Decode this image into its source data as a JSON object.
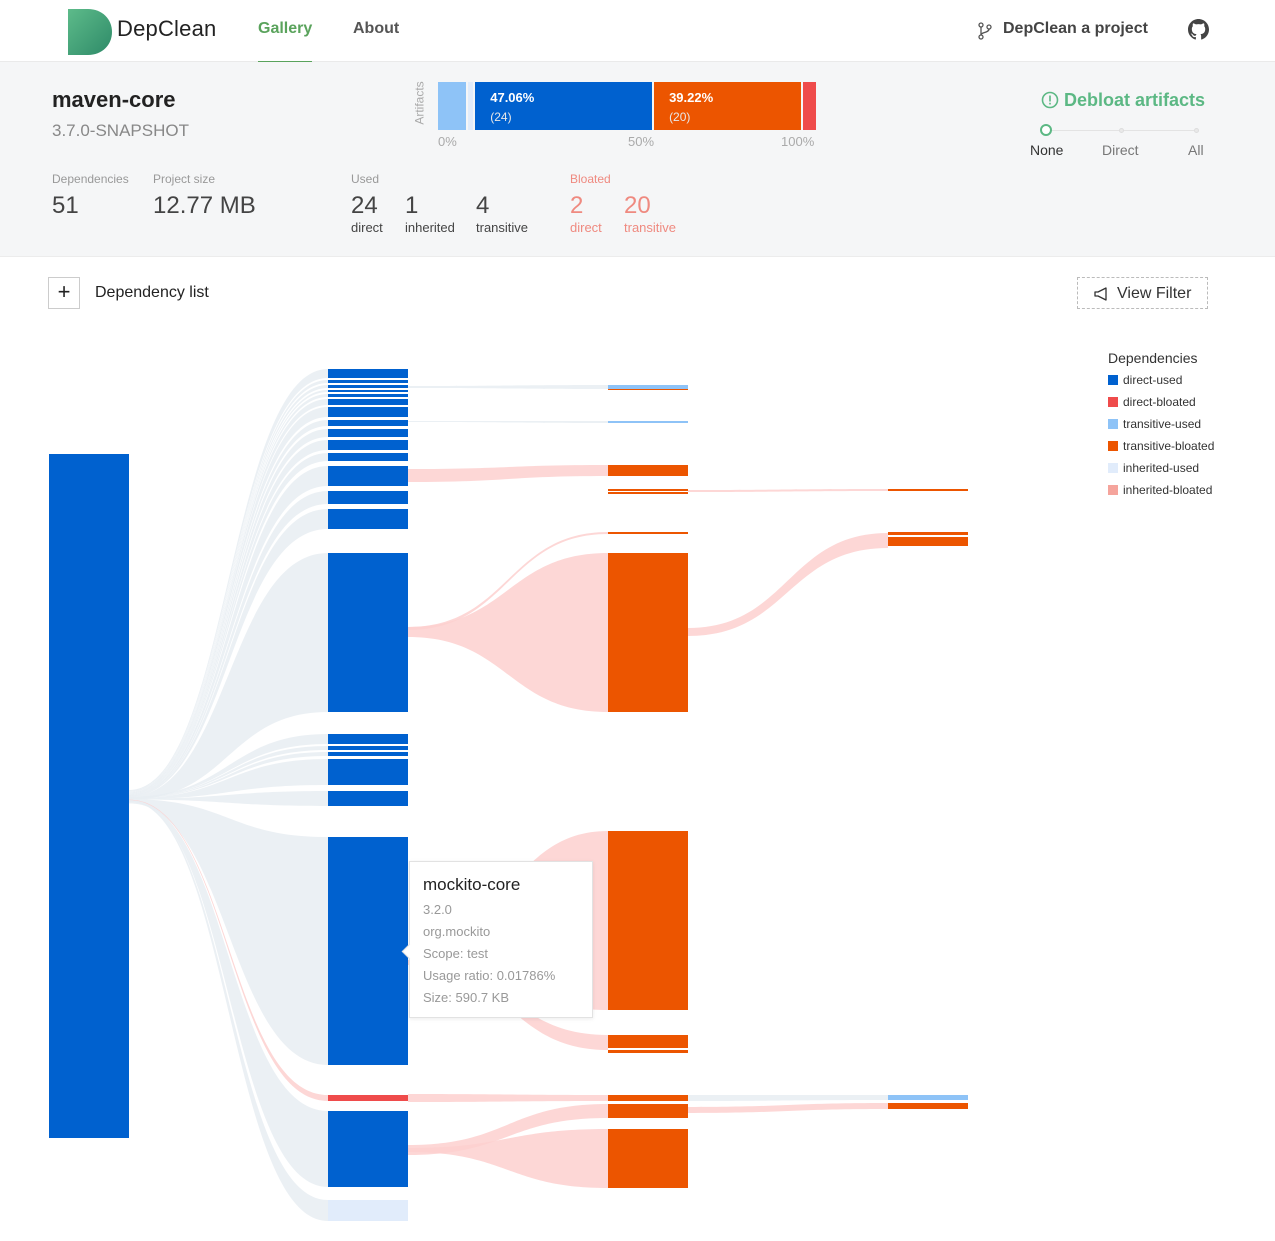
{
  "brand": {
    "name": "DepClean"
  },
  "nav": {
    "gallery": "Gallery",
    "about": "About",
    "cta": "DepClean a project"
  },
  "project": {
    "name": "maven-core",
    "version": "3.7.0-SNAPSHOT"
  },
  "stats": {
    "dependencies_label": "Dependencies",
    "dependencies": "51",
    "size_label": "Project size",
    "size": "12.77 MB",
    "used_label": "Used",
    "used_direct": "24",
    "used_direct_label": "direct",
    "used_inherited": "1",
    "used_inherited_label": "inherited",
    "used_transitive": "4",
    "used_transitive_label": "transitive",
    "bloated_label": "Bloated",
    "bloated_direct": "2",
    "bloated_direct_label": "direct",
    "bloated_transitive": "20",
    "bloated_transitive_label": "transitive"
  },
  "artifacts_bar": {
    "label": "Artifacts",
    "segments": [
      {
        "name": "transitive-used",
        "value": 0.0784,
        "color": "#8ec3f7"
      },
      {
        "name": "inherited-used",
        "value": 0.0196,
        "color": "#e1ecfb"
      },
      {
        "name": "direct-used",
        "value": 0.4706,
        "color": "#0061cf",
        "pct": "47.06%",
        "count": "(24)"
      },
      {
        "name": "transitive-bloated",
        "value": 0.3922,
        "color": "#ec5500",
        "pct": "39.22%",
        "count": "(20)"
      },
      {
        "name": "direct-bloated",
        "value": 0.0392,
        "color": "#ef4b4b"
      }
    ],
    "ticks": [
      "0%",
      "50%",
      "100%"
    ]
  },
  "debloat": {
    "title": "Debloat artifacts",
    "options": [
      "None",
      "Direct",
      "All"
    ],
    "selected": "None"
  },
  "toolbar": {
    "plus": "+",
    "deplist": "Dependency list",
    "view_filter": "View Filter"
  },
  "legend": {
    "title": "Dependencies",
    "items": [
      {
        "label": "direct-used",
        "color": "#0061cf"
      },
      {
        "label": "direct-bloated",
        "color": "#ef4b4b"
      },
      {
        "label": "transitive-used",
        "color": "#8ec3f7"
      },
      {
        "label": "transitive-bloated",
        "color": "#ec5500"
      },
      {
        "label": "inherited-used",
        "color": "#e1ecfb"
      },
      {
        "label": "inherited-bloated",
        "color": "#f5a49c"
      }
    ]
  },
  "tooltip": {
    "name": "mockito-core",
    "version": "3.2.0",
    "group": "org.mockito",
    "scope": "Scope: test",
    "usage": "Usage ratio: 0.01786%",
    "size": "Size: 590.7 KB"
  }
}
